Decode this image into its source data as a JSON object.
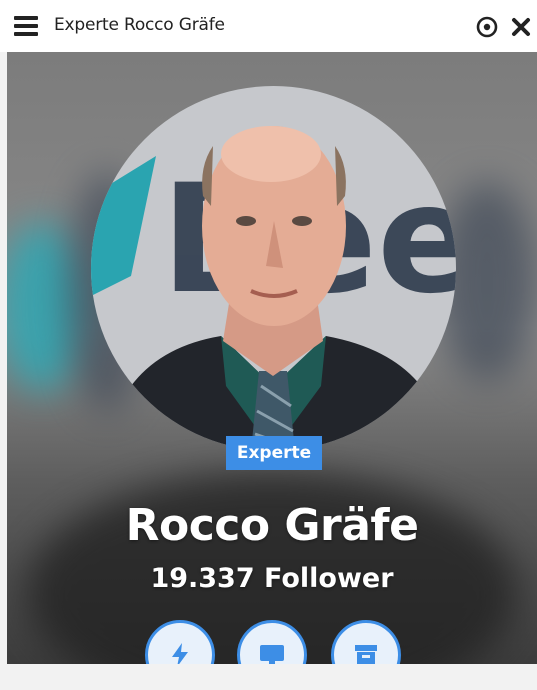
{
  "window": {
    "title": "Experte Rocco Gräfe",
    "menu_icon": "hamburger-menu-icon",
    "target_icon": "target-icon",
    "close_icon": "close-icon"
  },
  "profile": {
    "badge": "Experte",
    "name": "Rocco Gräfe",
    "followers": "19.337 Follower",
    "background_logo_text": "BeeG"
  },
  "actions": [
    {
      "icon": "lightning-icon"
    },
    {
      "icon": "monitor-icon"
    },
    {
      "icon": "archive-icon"
    }
  ],
  "colors": {
    "accent": "#3d8ee6",
    "title_text": "#222222",
    "hero_text": "#ffffff"
  }
}
